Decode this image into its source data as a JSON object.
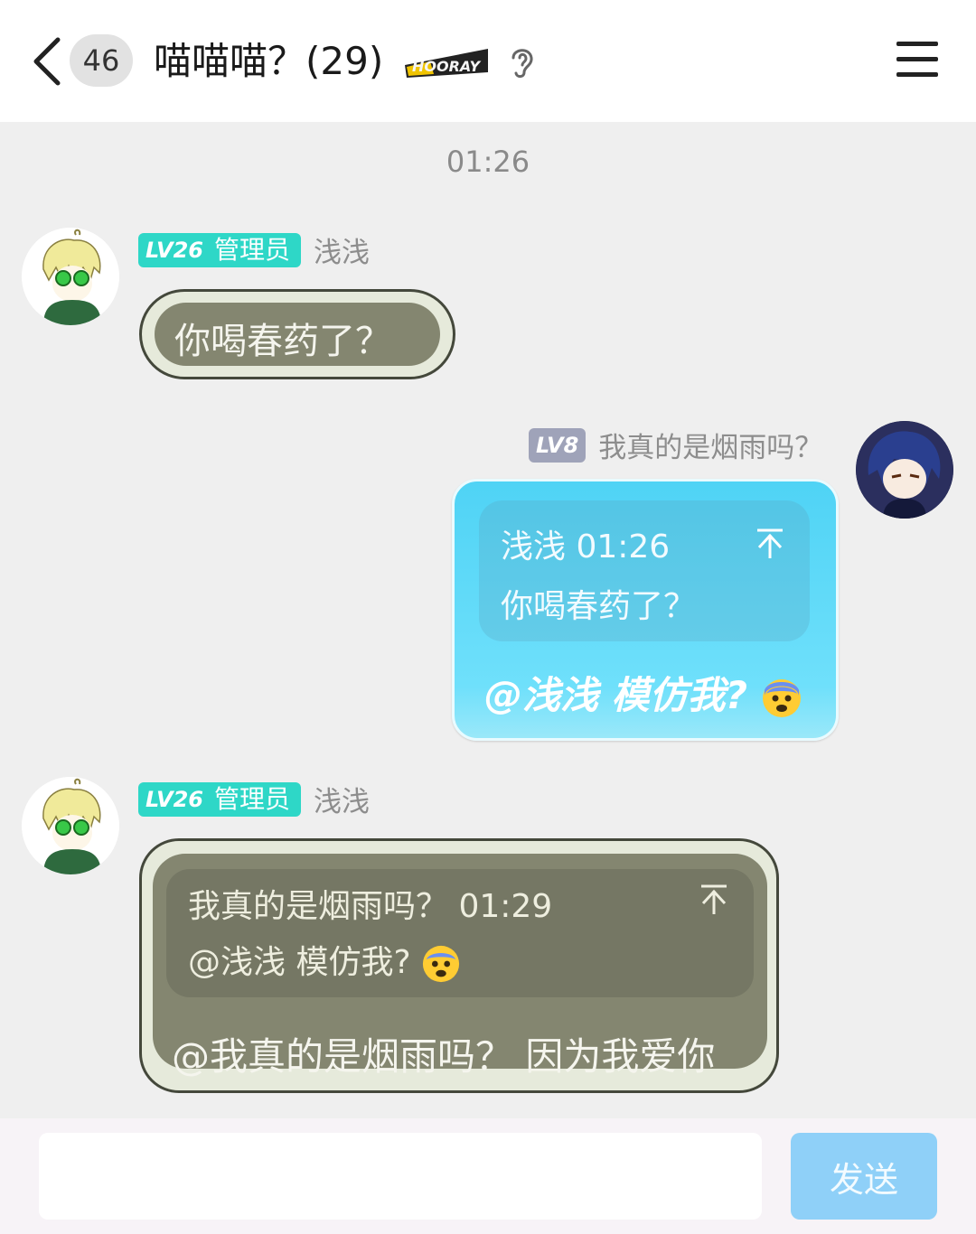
{
  "header": {
    "unread_count": "46",
    "title": "喵喵喵？(29)",
    "hooray_label": "HOORAY"
  },
  "chat": {
    "timestamp": "01:26",
    "messages": [
      {
        "level": "LV26",
        "role": "管理员",
        "sender": "浅浅",
        "text": "你喝春药了？"
      },
      {
        "level": "LV8",
        "sender": "我真的是烟雨吗？",
        "quote_header": "浅浅 01:26",
        "quote_text": "你喝春药了？",
        "text": "@浅浅 模仿我?"
      },
      {
        "level": "LV26",
        "role": "管理员",
        "sender": "浅浅",
        "quote_header": "我真的是烟雨吗？ 01:29",
        "quote_text": "@浅浅 模仿我?",
        "text": "@我真的是烟雨吗？ 因为我爱你"
      }
    ]
  },
  "composer": {
    "input_value": "",
    "send_label": "发送"
  },
  "colors": {
    "level_badge": "#2ed7c7",
    "level_badge_low": "#9fa3b9",
    "bubble_blue": "#4fd3f5",
    "bubble_olive": "#848670",
    "send_button": "#8fd0f8"
  },
  "icons": [
    "back-arrow-icon",
    "ear-icon",
    "menu-icon",
    "scroll-to-quote-icon",
    "anxious-face-emoji"
  ]
}
